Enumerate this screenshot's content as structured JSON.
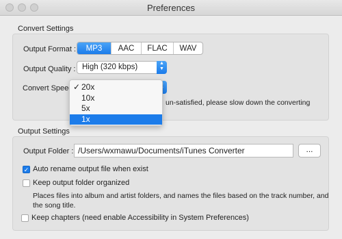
{
  "window": {
    "title": "Preferences"
  },
  "convert_settings": {
    "section_label": "Convert Settings",
    "output_format_label": "Output Format :",
    "formats": [
      "MP3",
      "AAC",
      "FLAC",
      "WAV"
    ],
    "selected_format": "MP3",
    "output_quality_label": "Output Quality :",
    "output_quality_value": "High (320 kbps)",
    "convert_speed_label": "Convert Speed :",
    "speed_options": [
      "20x",
      "10x",
      "5x",
      "1x"
    ],
    "checked_speed": "20x",
    "highlighted_speed": "1x",
    "speed_hint": "un-satisfied, please slow down the converting"
  },
  "output_settings": {
    "section_label": "Output Settings",
    "output_folder_label": "Output Folder :",
    "output_folder_value": "/Users/wxmawu/Documents/iTunes Converter",
    "browse_label": "...",
    "auto_rename_label": "Auto rename output file when exist",
    "auto_rename_checked": true,
    "keep_organized_label": "Keep output folder organized",
    "keep_organized_checked": false,
    "organized_description_line1": "Places files into album and artist folders, and names the files based on the track number, and",
    "organized_description_line2": "the song title.",
    "keep_chapters_label": "Keep chapters (need enable Accessibility in System Preferences)",
    "keep_chapters_checked": false
  }
}
